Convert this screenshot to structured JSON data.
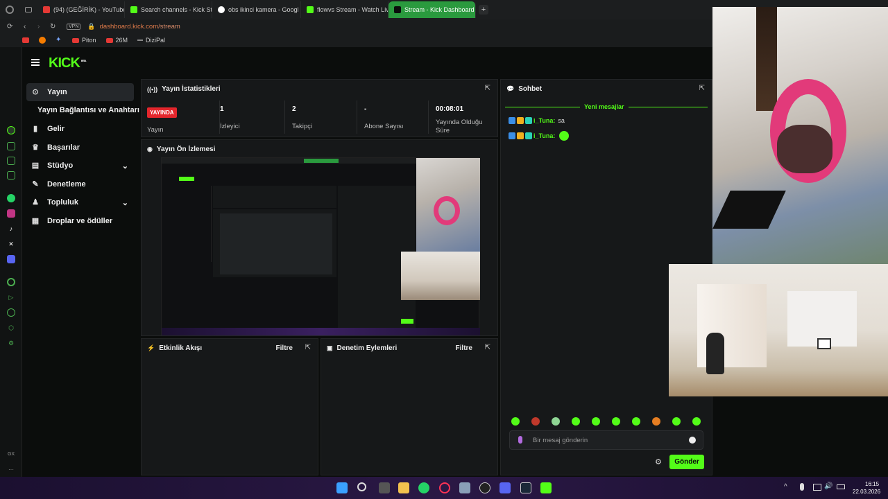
{
  "browser": {
    "tabs": [
      {
        "label": "(94) (GEĞİRİK) - YouTube",
        "icon": "youtube-icon",
        "color": "#e53935"
      },
      {
        "label": "Search channels - Kick St",
        "icon": "kick-icon",
        "color": "#53fc18"
      },
      {
        "label": "obs ikinci kamera - Googl",
        "icon": "google-icon",
        "color": "#ffffff"
      },
      {
        "label": "flowvs Stream - Watch Liv",
        "icon": "kick-icon",
        "color": "#53fc18"
      },
      {
        "label": "Stream - Kick Dashboard",
        "icon": "kick-icon",
        "color": "#53fc18"
      }
    ],
    "new_tab": "+",
    "vpn_label": "VPN",
    "url_domain": "dashboard.kick.com",
    "url_path": "/stream",
    "bookmarks": [
      "Piton",
      "26M",
      "DiziPal"
    ]
  },
  "kick": {
    "logo": "KICK",
    "beta": "BETA",
    "nav": [
      {
        "label": "Yayın",
        "icon": "broadcast-icon"
      },
      {
        "label": "Yayın Bağlantısı ve Anahtarı",
        "icon": ""
      },
      {
        "label": "Gelir",
        "icon": "chart-icon"
      },
      {
        "label": "Başarılar",
        "icon": "trophy-icon"
      },
      {
        "label": "Stüdyo",
        "icon": "studio-icon"
      },
      {
        "label": "Denetleme",
        "icon": "wrench-icon"
      },
      {
        "label": "Topluluk",
        "icon": "community-icon"
      },
      {
        "label": "Droplar ve ödüller",
        "icon": "drops-icon"
      }
    ],
    "stats_panel": {
      "title": "Yayın İstatistikleri",
      "live_badge": "YAYINDA",
      "live_label": "Yayın",
      "viewers_value": "1",
      "viewers_label": "İzleyici",
      "followers_value": "2",
      "followers_label": "Takipçi",
      "subs_value": "-",
      "subs_label": "Abone Sayısı",
      "uptime_value": "00:08:01",
      "uptime_label": "Yayında Olduğu Süre"
    },
    "preview_panel": {
      "title": "Yayın Ön İzlemesi"
    },
    "activity_panel": {
      "title": "Etkinlik Akışı",
      "filter": "Filtre"
    },
    "moderation_panel": {
      "title": "Denetim Eylemleri",
      "filter": "Filtre"
    },
    "chat": {
      "title": "Sohbet",
      "new_messages": "Yeni mesajlar",
      "messages": [
        {
          "user": "i_Tuna:",
          "text": "sa"
        },
        {
          "user": "i_Tuna:",
          "text": ""
        }
      ],
      "input_placeholder": "Bir mesaj gönderin",
      "send_label": "Gönder"
    }
  },
  "rail_labels": {
    "gx": "GX",
    "more": "···"
  },
  "taskbar": {
    "time": "16:15",
    "date": "22.03.2026"
  },
  "colors": {
    "accent": "#53fc18",
    "live": "#e4262c",
    "panel": "#161819",
    "background": "#0b0d0c"
  }
}
